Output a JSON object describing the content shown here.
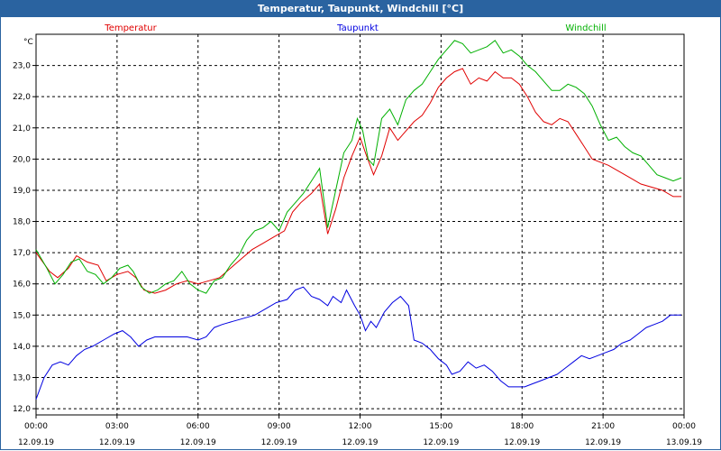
{
  "window": {
    "title": "Temperatur, Taupunkt, Windchill [°C]"
  },
  "chart_data": {
    "type": "line",
    "title": "Temperatur, Taupunkt, Windchill [°C]",
    "ylabel": "°C",
    "xlabel": "",
    "ylim": [
      11.8,
      24.0
    ],
    "xlim": [
      0,
      24
    ],
    "yticks": [
      12.0,
      13.0,
      14.0,
      15.0,
      16.0,
      17.0,
      18.0,
      19.0,
      20.0,
      21.0,
      22.0,
      23.0
    ],
    "yticks_text": [
      "12,0",
      "13,0",
      "14,0",
      "15,0",
      "16,0",
      "17,0",
      "18,0",
      "19,0",
      "20,0",
      "21,0",
      "22,0",
      "23,0"
    ],
    "xticks": [
      0,
      3,
      6,
      9,
      12,
      15,
      18,
      21,
      24
    ],
    "xticks_text": [
      "00:00",
      "03:00",
      "06:00",
      "09:00",
      "12:00",
      "15:00",
      "18:00",
      "21:00",
      "00:00"
    ],
    "xticks_date": [
      "12.09.19",
      "12.09.19",
      "12.09.19",
      "12.09.19",
      "12.09.19",
      "12.09.19",
      "12.09.19",
      "12.09.19",
      "13.09.19"
    ],
    "grid": true,
    "legend_position": "top",
    "series": [
      {
        "name": "Temperatur",
        "color": "#e00000",
        "x": [
          0,
          0.5,
          0.8,
          1.2,
          1.5,
          1.9,
          2.3,
          2.6,
          3.0,
          3.4,
          3.7,
          4.0,
          4.4,
          4.8,
          5.2,
          5.6,
          6.0,
          6.4,
          6.8,
          7.2,
          7.6,
          8.0,
          8.4,
          8.8,
          9.2,
          9.5,
          9.8,
          10.2,
          10.5,
          10.8,
          11.1,
          11.4,
          11.7,
          12.0,
          12.2,
          12.5,
          12.8,
          13.1,
          13.4,
          13.7,
          14.0,
          14.3,
          14.6,
          14.9,
          15.2,
          15.5,
          15.8,
          16.1,
          16.4,
          16.7,
          17.0,
          17.3,
          17.6,
          17.9,
          18.2,
          18.5,
          18.8,
          19.1,
          19.4,
          19.7,
          20.0,
          20.3,
          20.6,
          20.9,
          21.2,
          21.6,
          22.0,
          22.4,
          22.8,
          23.2,
          23.6,
          23.9
        ],
        "y": [
          17.0,
          16.4,
          16.2,
          16.5,
          16.9,
          16.7,
          16.6,
          16.1,
          16.3,
          16.4,
          16.2,
          15.8,
          15.7,
          15.8,
          16.0,
          16.1,
          16.0,
          16.1,
          16.2,
          16.5,
          16.8,
          17.1,
          17.3,
          17.5,
          17.7,
          18.3,
          18.6,
          18.9,
          19.2,
          17.6,
          18.4,
          19.4,
          20.1,
          20.7,
          20.2,
          19.5,
          20.1,
          21.0,
          20.6,
          20.9,
          21.2,
          21.4,
          21.8,
          22.3,
          22.6,
          22.8,
          22.9,
          22.4,
          22.6,
          22.5,
          22.8,
          22.6,
          22.6,
          22.4,
          22.0,
          21.5,
          21.2,
          21.1,
          21.3,
          21.2,
          20.8,
          20.4,
          20.0,
          19.9,
          19.8,
          19.6,
          19.4,
          19.2,
          19.1,
          19.0,
          18.8,
          18.8
        ]
      },
      {
        "name": "Taupunkt",
        "color": "#0000e0",
        "x": [
          0,
          0.3,
          0.6,
          0.9,
          1.2,
          1.5,
          1.8,
          2.1,
          2.5,
          2.9,
          3.2,
          3.5,
          3.8,
          4.1,
          4.4,
          4.8,
          5.2,
          5.6,
          6.0,
          6.3,
          6.6,
          6.9,
          7.3,
          7.7,
          8.1,
          8.5,
          8.9,
          9.3,
          9.6,
          9.9,
          10.2,
          10.5,
          10.8,
          11.0,
          11.3,
          11.5,
          11.8,
          12.0,
          12.2,
          12.4,
          12.6,
          12.9,
          13.2,
          13.5,
          13.8,
          14.0,
          14.3,
          14.6,
          14.9,
          15.2,
          15.4,
          15.7,
          16.0,
          16.3,
          16.6,
          16.9,
          17.2,
          17.5,
          17.8,
          18.1,
          18.4,
          18.7,
          19.0,
          19.3,
          19.6,
          19.9,
          20.2,
          20.5,
          20.8,
          21.1,
          21.4,
          21.7,
          22.0,
          22.3,
          22.6,
          22.9,
          23.2,
          23.5,
          23.9
        ],
        "y": [
          12.3,
          13.0,
          13.4,
          13.5,
          13.4,
          13.7,
          13.9,
          14.0,
          14.2,
          14.4,
          14.5,
          14.3,
          14.0,
          14.2,
          14.3,
          14.3,
          14.3,
          14.3,
          14.2,
          14.3,
          14.6,
          14.7,
          14.8,
          14.9,
          15.0,
          15.2,
          15.4,
          15.5,
          15.8,
          15.9,
          15.6,
          15.5,
          15.3,
          15.6,
          15.4,
          15.8,
          15.3,
          15.0,
          14.5,
          14.8,
          14.6,
          15.1,
          15.4,
          15.6,
          15.3,
          14.2,
          14.1,
          13.9,
          13.6,
          13.4,
          13.1,
          13.2,
          13.5,
          13.3,
          13.4,
          13.2,
          12.9,
          12.7,
          12.7,
          12.7,
          12.8,
          12.9,
          13.0,
          13.1,
          13.3,
          13.5,
          13.7,
          13.6,
          13.7,
          13.8,
          13.9,
          14.1,
          14.2,
          14.4,
          14.6,
          14.7,
          14.8,
          15.0,
          15.0
        ]
      },
      {
        "name": "Windchill",
        "color": "#00b000",
        "x": [
          0,
          0.4,
          0.7,
          1.0,
          1.3,
          1.6,
          1.9,
          2.2,
          2.5,
          2.8,
          3.1,
          3.4,
          3.6,
          3.9,
          4.2,
          4.5,
          4.8,
          5.1,
          5.4,
          5.7,
          6.0,
          6.3,
          6.6,
          6.9,
          7.2,
          7.5,
          7.8,
          8.1,
          8.4,
          8.7,
          9.0,
          9.3,
          9.6,
          9.9,
          10.2,
          10.5,
          10.8,
          11.1,
          11.4,
          11.7,
          11.9,
          12.1,
          12.3,
          12.5,
          12.8,
          13.1,
          13.4,
          13.7,
          14.0,
          14.3,
          14.6,
          14.9,
          15.2,
          15.5,
          15.8,
          16.1,
          16.4,
          16.7,
          17.0,
          17.3,
          17.6,
          17.9,
          18.2,
          18.5,
          18.8,
          19.1,
          19.4,
          19.7,
          20.0,
          20.3,
          20.6,
          20.9,
          21.2,
          21.5,
          21.8,
          22.1,
          22.4,
          22.7,
          23.0,
          23.3,
          23.6,
          23.9
        ],
        "y": [
          17.1,
          16.5,
          16.0,
          16.3,
          16.7,
          16.8,
          16.4,
          16.3,
          16.0,
          16.2,
          16.5,
          16.6,
          16.4,
          15.9,
          15.7,
          15.8,
          16.0,
          16.1,
          16.4,
          16.0,
          15.8,
          15.7,
          16.1,
          16.2,
          16.6,
          16.9,
          17.4,
          17.7,
          17.8,
          18.0,
          17.7,
          18.3,
          18.6,
          18.9,
          19.3,
          19.7,
          17.8,
          19.0,
          20.2,
          20.6,
          21.3,
          20.9,
          20.0,
          19.8,
          21.3,
          21.6,
          21.1,
          21.9,
          22.2,
          22.4,
          22.8,
          23.2,
          23.5,
          23.8,
          23.7,
          23.4,
          23.5,
          23.6,
          23.8,
          23.4,
          23.5,
          23.3,
          23.0,
          22.8,
          22.5,
          22.2,
          22.2,
          22.4,
          22.3,
          22.1,
          21.7,
          21.1,
          20.6,
          20.7,
          20.4,
          20.2,
          20.1,
          19.8,
          19.5,
          19.4,
          19.3,
          19.4
        ]
      }
    ]
  }
}
